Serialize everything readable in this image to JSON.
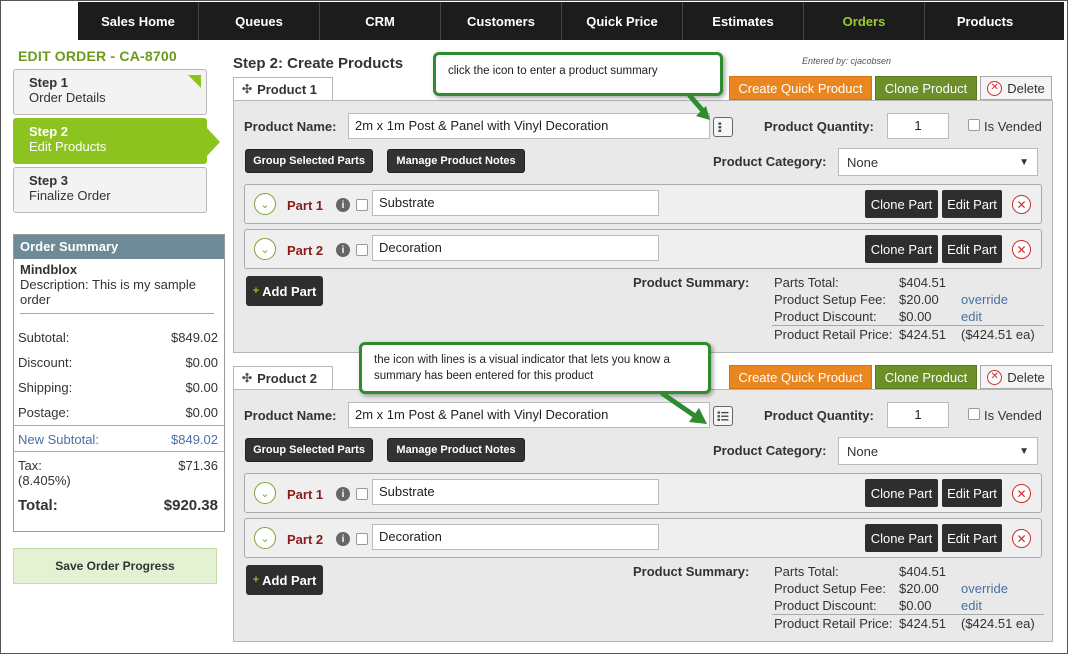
{
  "nav": {
    "items": [
      {
        "label": "Sales Home",
        "active": false
      },
      {
        "label": "Queues",
        "active": false
      },
      {
        "label": "CRM",
        "active": false
      },
      {
        "label": "Customers",
        "active": false
      },
      {
        "label": "Quick Price",
        "active": false
      },
      {
        "label": "Estimates",
        "active": false
      },
      {
        "label": "Orders",
        "active": true
      },
      {
        "label": "Products",
        "active": false
      }
    ]
  },
  "sidebar": {
    "title": "EDIT ORDER - CA-8700",
    "steps": [
      {
        "num": "Step 1",
        "label": "Order Details"
      },
      {
        "num": "Step 2",
        "label": "Edit Products"
      },
      {
        "num": "Step 3",
        "label": "Finalize Order"
      }
    ],
    "order_summary": {
      "heading": "Order Summary",
      "customer": "Mindblox",
      "description": "Description:  This is my sample order",
      "rows": [
        {
          "label": "Subtotal:",
          "value": "$849.02"
        },
        {
          "label": "Discount:",
          "value": "$0.00"
        },
        {
          "label": "Shipping:",
          "value": "$0.00"
        },
        {
          "label": "Postage:",
          "value": "$0.00"
        }
      ],
      "new_subtotal": {
        "label": "New Subtotal:",
        "value": "$849.02"
      },
      "tax": {
        "label": "Tax:",
        "rate": "(8.405%)",
        "value": "$71.36"
      },
      "total": {
        "label": "Total:",
        "value": "$920.38"
      }
    },
    "save_label": "Save Order Progress"
  },
  "main": {
    "title": "Step 2: Create Products",
    "entered_by": "Entered by:  cjacobsen",
    "products": [
      {
        "tab": "Product 1",
        "buttons": {
          "quick": "Create Quick Product",
          "clone": "Clone Product",
          "delete": "Delete"
        },
        "name_label": "Product Name:",
        "name_value": "2m x 1m Post & Panel with Vinyl Decoration",
        "qty_label": "Product Quantity:",
        "qty_value": "1",
        "vended_label": "Is Vended",
        "group_label": "Group Selected Parts",
        "notes_label": "Manage Product Notes",
        "category_label": "Product Category:",
        "category_value": "None",
        "parts": [
          {
            "label": "Part 1",
            "value": "Substrate",
            "clone": "Clone Part",
            "edit": "Edit Part"
          },
          {
            "label": "Part 2",
            "value": "Decoration",
            "clone": "Clone Part",
            "edit": "Edit Part"
          }
        ],
        "add_part": "Add Part",
        "summary_label": "Product Summary:",
        "summary": {
          "parts_total": {
            "label": "Parts Total:",
            "value": "$404.51"
          },
          "setup_fee": {
            "label": "Product Setup Fee:",
            "value": "$20.00",
            "link": "override"
          },
          "discount": {
            "label": "Product Discount:",
            "value": "$0.00",
            "link": "edit"
          },
          "retail": {
            "label": "Product Retail Price:",
            "value": "$424.51",
            "each": "($424.51 ea)"
          }
        }
      },
      {
        "tab": "Product 2",
        "buttons": {
          "quick": "Create Quick Product",
          "clone": "Clone Product",
          "delete": "Delete"
        },
        "name_label": "Product Name:",
        "name_value": "2m x 1m Post & Panel with Vinyl Decoration",
        "qty_label": "Product Quantity:",
        "qty_value": "1",
        "vended_label": "Is Vended",
        "group_label": "Group Selected Parts",
        "notes_label": "Manage Product Notes",
        "category_label": "Product Category:",
        "category_value": "None",
        "parts": [
          {
            "label": "Part 1",
            "value": "Substrate",
            "clone": "Clone Part",
            "edit": "Edit Part"
          },
          {
            "label": "Part 2",
            "value": "Decoration",
            "clone": "Clone Part",
            "edit": "Edit Part"
          }
        ],
        "add_part": "Add Part",
        "summary_label": "Product Summary:",
        "summary": {
          "parts_total": {
            "label": "Parts Total:",
            "value": "$404.51"
          },
          "setup_fee": {
            "label": "Product Setup Fee:",
            "value": "$20.00",
            "link": "override"
          },
          "discount": {
            "label": "Product Discount:",
            "value": "$0.00",
            "link": "edit"
          },
          "retail": {
            "label": "Product Retail Price:",
            "value": "$424.51",
            "each": "($424.51 ea)"
          }
        }
      }
    ]
  },
  "callouts": {
    "first": "click the icon to enter a product summary",
    "second": "the icon with lines is a visual indicator that lets you know a summary has been entered for this product"
  },
  "colors": {
    "accent_green": "#8cc31e",
    "title_green": "#6a9a1f",
    "orange": "#e9861f",
    "olive": "#6d8f2a",
    "part_red": "#8b1a1a",
    "callout_border": "#2e8b2e"
  },
  "icons": [
    "drag-handle-icon",
    "close-circle-icon",
    "chevron-down-icon",
    "info-icon",
    "summary-icon",
    "summary-lines-icon",
    "dropdown-caret-icon",
    "plus-icon",
    "arrow-icon"
  ]
}
